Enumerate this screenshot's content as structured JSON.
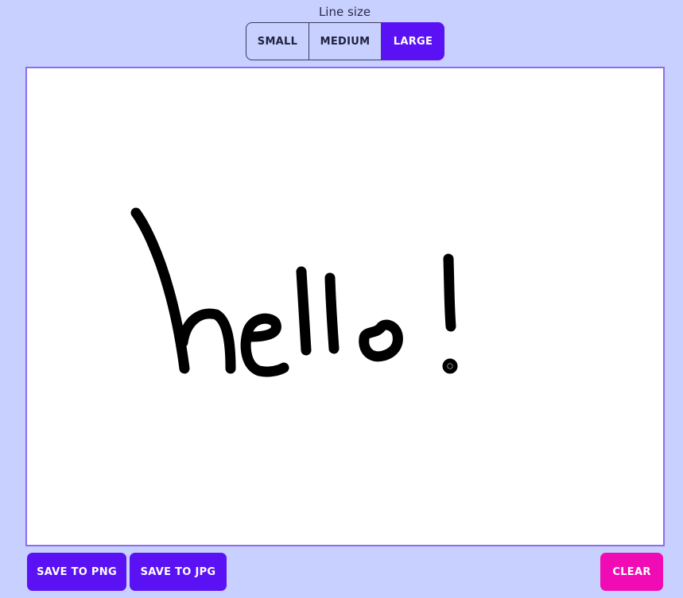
{
  "line_size": {
    "label": "Line size",
    "options": [
      "SMALL",
      "MEDIUM",
      "LARGE"
    ],
    "selected": "LARGE"
  },
  "canvas": {
    "drawing_text": "hello!"
  },
  "actions": {
    "save_png_label": "SAVE TO PNG",
    "save_jpg_label": "SAVE TO JPG",
    "clear_label": "CLEAR"
  },
  "colors": {
    "background": "#c7d0fe",
    "primary": "#5a12f5",
    "danger": "#f00bb4",
    "canvas_border": "#8b6cf2",
    "stroke": "#000000"
  }
}
